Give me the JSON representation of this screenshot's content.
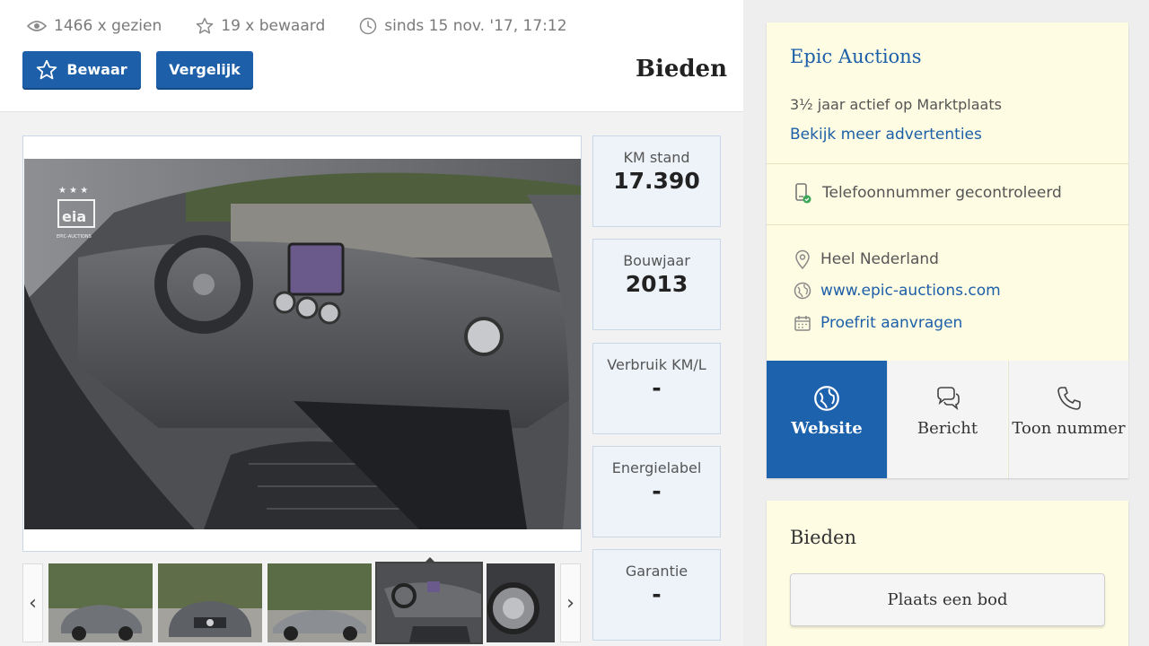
{
  "stats": {
    "views": "1466 x gezien",
    "saved": "19 x bewaard",
    "since": "sinds 15 nov. '17, 17:12"
  },
  "buttons": {
    "bewaar": "Bewaar",
    "vergelijk": "Vergelijk"
  },
  "heading": "Bieden",
  "specs": [
    {
      "label": "KM stand",
      "value": "17.390"
    },
    {
      "label": "Bouwjaar",
      "value": "2013"
    },
    {
      "label": "Verbruik KM/L",
      "value": "-"
    },
    {
      "label": "Energielabel",
      "value": "-"
    },
    {
      "label": "Garantie",
      "value": "-"
    }
  ],
  "thumbs": {
    "prev": "‹",
    "next": "›",
    "active_index": 3
  },
  "seller": {
    "name": "Epic Auctions",
    "active": "3½ jaar actief op Marktplaats",
    "more_link": "Bekijk meer advertenties",
    "phone_checked": "Telefoonnummer gecontroleerd",
    "location": "Heel Nederland",
    "website_link": "www.epic-auctions.com",
    "testdrive": "Proefrit aanvragen"
  },
  "actions": {
    "website": "Website",
    "bericht": "Bericht",
    "toon": "Toon nummer"
  },
  "bid": {
    "title": "Bieden",
    "button": "Plaats een bod"
  },
  "colors": {
    "primary_blue": "#1d5fa8",
    "seller_bg": "#fefce2"
  }
}
